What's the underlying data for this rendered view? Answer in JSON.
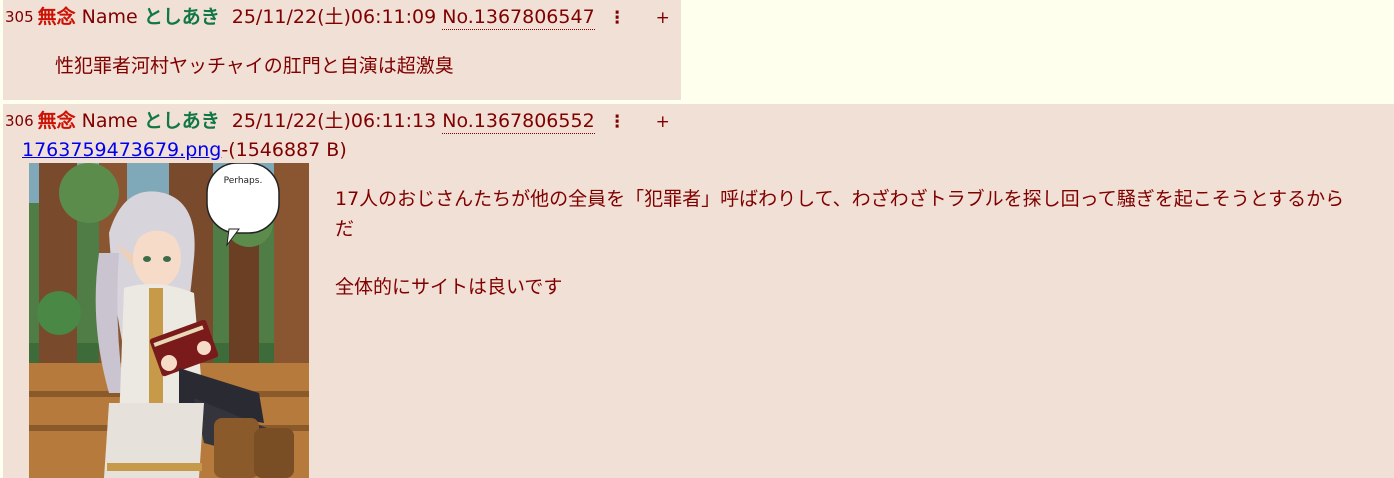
{
  "posts": [
    {
      "rsc": "305",
      "subject": "無念",
      "name_label": "Name",
      "name": "としあき",
      "datetime": "25/11/22(土)06:11:09",
      "number": "No.1367806547",
      "menu_glyph": "⋮",
      "plus_glyph": "+",
      "comment": [
        "性犯罪者河村ヤッチャイの肛門と自演は超激臭"
      ]
    },
    {
      "rsc": "306",
      "subject": "無念",
      "name_label": "Name",
      "name": "としあき",
      "datetime": "25/11/22(土)06:11:13",
      "number": "No.1367806552",
      "menu_glyph": "⋮",
      "plus_glyph": "+",
      "file": {
        "name": "1763759473679.png",
        "separator": "-",
        "size": "(1546887 B)",
        "speech_text": "Perhaps."
      },
      "comment": [
        "17人のおじさんたちが他の全員を「犯罪者」呼ばわりして、わざわざトラブルを探し回って騒ぎを起こそうとするからだ",
        "全体的にサイトは良いです"
      ]
    }
  ],
  "colors": {
    "page_bg": "#ffffee",
    "post_bg": "#f0e0d6",
    "text": "#800000",
    "subject": "#cc1105",
    "name": "#117743",
    "link": "#0000ee"
  }
}
